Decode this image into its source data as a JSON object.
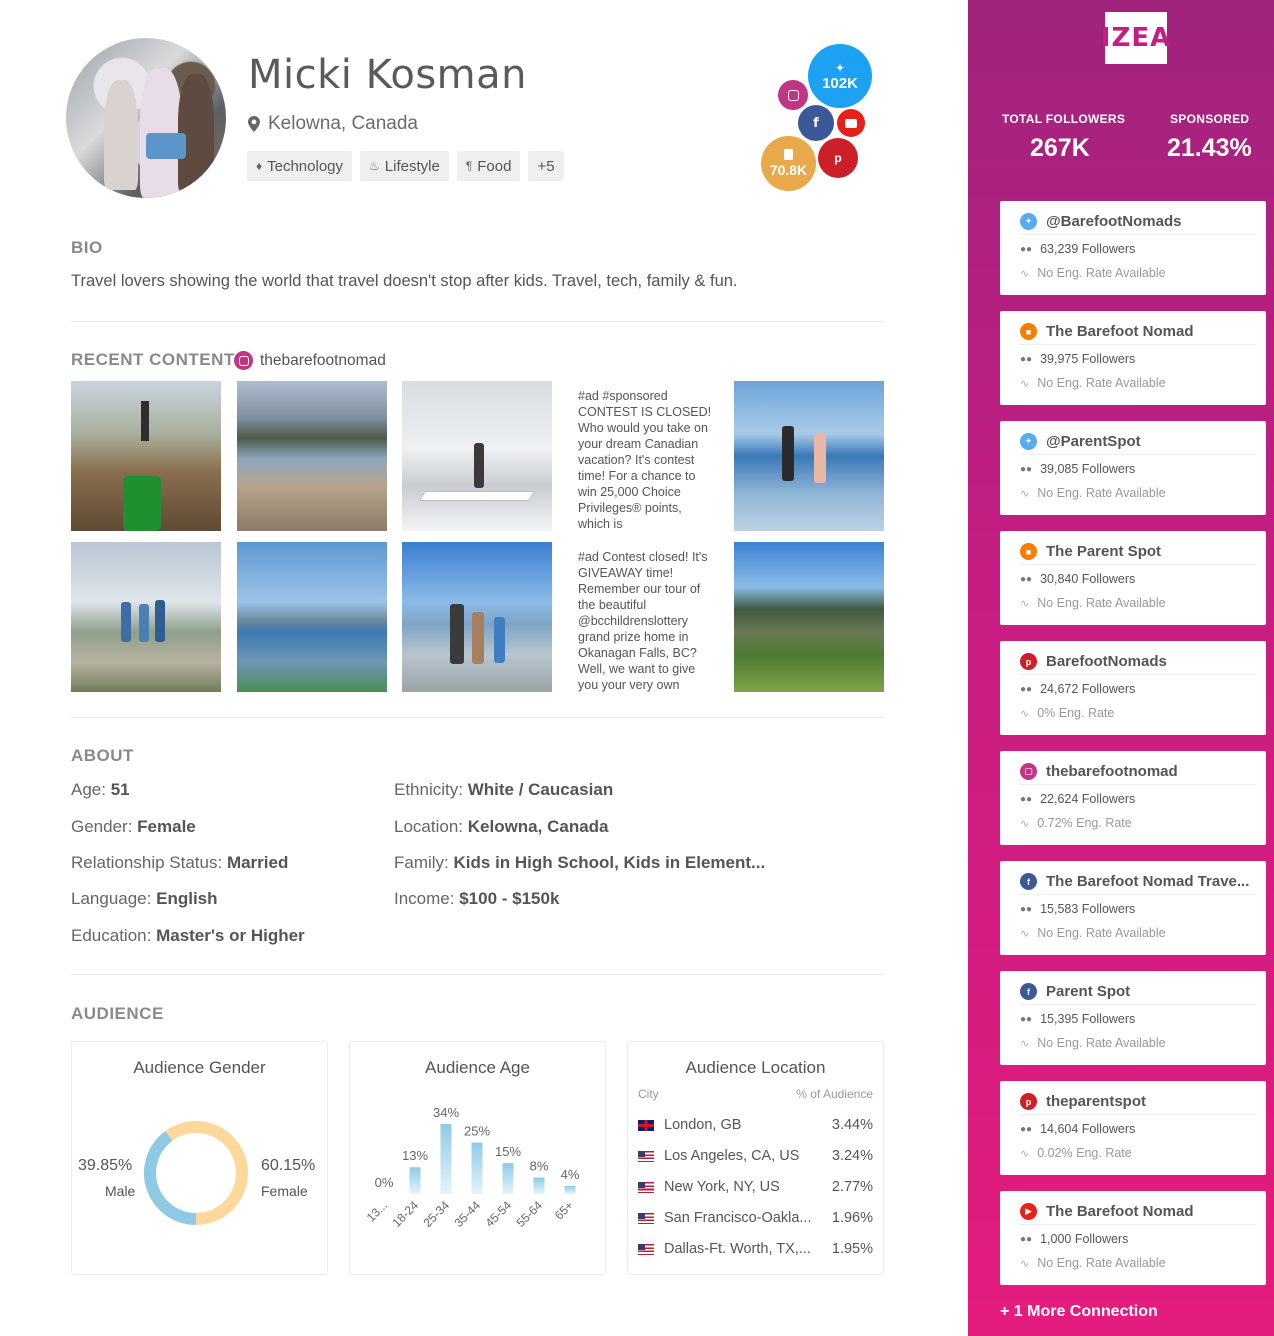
{
  "profile": {
    "name": "Micki Kosman",
    "location": "Kelowna, Canada",
    "tags": [
      {
        "label": "Technology",
        "icon": "tag-icon"
      },
      {
        "label": "Lifestyle",
        "icon": "lifestyle-icon"
      },
      {
        "label": "Food",
        "icon": "fork-knife-icon"
      },
      {
        "label": "+5",
        "icon": ""
      }
    ]
  },
  "bubbles": {
    "twitter": "102K",
    "blog": "70.8K"
  },
  "bio": {
    "title": "BIO",
    "text": "Travel lovers showing the world that travel doesn't stop after kids. Travel, tech, family & fun."
  },
  "recent_content": {
    "title": "RECENT CONTENT",
    "handle": "thebarefootnomad",
    "text_posts": [
      "#ad #sponsored CONTEST IS CLOSED! Who would you take on your dream Canadian vacation? It's contest time! For a chance to win 25,000 Choice Privileges® points, which is",
      "#ad Contest closed! It's GIVEAWAY time! Remember our tour of the beautiful @bcchildrenslottery grand prize home in Okanagan Falls, BC? Well, we want to give you your very own"
    ]
  },
  "about": {
    "title": "ABOUT",
    "age_label": "Age:",
    "age": "51",
    "gender_label": "Gender:",
    "gender": "Female",
    "relationship_label": "Relationship Status:",
    "relationship": "Married",
    "language_label": "Language:",
    "language": "English",
    "education_label": "Education:",
    "education": "Master's or Higher",
    "ethnicity_label": "Ethnicity:",
    "ethnicity": "White / Caucasian",
    "location_label": "Location:",
    "location": "Kelowna, Canada",
    "family_label": "Family:",
    "family": "Kids in High School, Kids in Element...",
    "income_label": "Income:",
    "income": "$100 - $150k"
  },
  "audience": {
    "title": "AUDIENCE",
    "gender": {
      "title": "Audience Gender",
      "male_pct": "39.85%",
      "male_label": "Male",
      "male_value": 39.85,
      "female_pct": "60.15%",
      "female_label": "Female",
      "female_value": 60.15,
      "male_color": "#8ecae6",
      "female_color": "#fcd99a"
    },
    "location": {
      "title": "Audience Location",
      "col_city": "City",
      "col_pct": "% of Audience",
      "rows": [
        {
          "flag": "gb-flag-icon",
          "city": "London, GB",
          "pct": "3.44%"
        },
        {
          "flag": "us-flag-icon",
          "city": "Los Angeles, CA, US",
          "pct": "3.24%"
        },
        {
          "flag": "us-flag-icon",
          "city": "New York, NY, US",
          "pct": "2.77%"
        },
        {
          "flag": "us-flag-icon",
          "city": "San Francisco-Oakla...",
          "pct": "1.96%"
        },
        {
          "flag": "us-flag-icon",
          "city": "Dallas-Ft. Worth, TX,...",
          "pct": "1.95%"
        }
      ]
    }
  },
  "chart_data": {
    "type": "bar",
    "title": "Audience Age",
    "categories": [
      "13...",
      "18-24",
      "25-34",
      "35-44",
      "45-54",
      "55-64",
      "65+"
    ],
    "values": [
      0,
      13,
      34,
      25,
      15,
      8,
      4
    ],
    "value_labels": [
      "0%",
      "13%",
      "34%",
      "25%",
      "15%",
      "8%",
      "4%"
    ],
    "ylim": [
      0,
      34
    ],
    "grid": false,
    "bar_color": "#8ecae6"
  },
  "sidebar": {
    "logo": "IZEA",
    "total_followers_label": "TOTAL FOLLOWERS",
    "total_followers": "267K",
    "sponsored_label": "SPONSORED",
    "sponsored": "21.43%",
    "accounts": [
      {
        "network": "twitter",
        "color": "#55acee",
        "name": "@BarefootNomads",
        "followers": "63,239 Followers",
        "eng": "No Eng. Rate Available"
      },
      {
        "network": "blog",
        "color": "#f57d00",
        "name": "The Barefoot Nomad",
        "followers": "39,975 Followers",
        "eng": "No Eng. Rate Available"
      },
      {
        "network": "twitter",
        "color": "#55acee",
        "name": "@ParentSpot",
        "followers": "39,085 Followers",
        "eng": "No Eng. Rate Available"
      },
      {
        "network": "blog",
        "color": "#f57d00",
        "name": "The Parent Spot",
        "followers": "30,840 Followers",
        "eng": "No Eng. Rate Available"
      },
      {
        "network": "pinterest",
        "color": "#cb2027",
        "name": "BarefootNomads",
        "followers": "24,672 Followers",
        "eng": "0% Eng. Rate"
      },
      {
        "network": "instagram",
        "color": "#c13584",
        "name": "thebarefootnomad",
        "followers": "22,624 Followers",
        "eng": "0.72% Eng. Rate"
      },
      {
        "network": "facebook",
        "color": "#3b5998",
        "name": "The Barefoot Nomad Trave...",
        "followers": "15,583 Followers",
        "eng": "No Eng. Rate Available"
      },
      {
        "network": "facebook",
        "color": "#3b5998",
        "name": "Parent Spot",
        "followers": "15,395 Followers",
        "eng": "No Eng. Rate Available"
      },
      {
        "network": "pinterest",
        "color": "#cb2027",
        "name": "theparentspot",
        "followers": "14,604 Followers",
        "eng": "0.02% Eng. Rate"
      },
      {
        "network": "youtube",
        "color": "#e62117",
        "name": "The Barefoot Nomad",
        "followers": "1,000 Followers",
        "eng": "No Eng. Rate Available"
      }
    ],
    "more_connections": "+ 1 More Connection"
  }
}
